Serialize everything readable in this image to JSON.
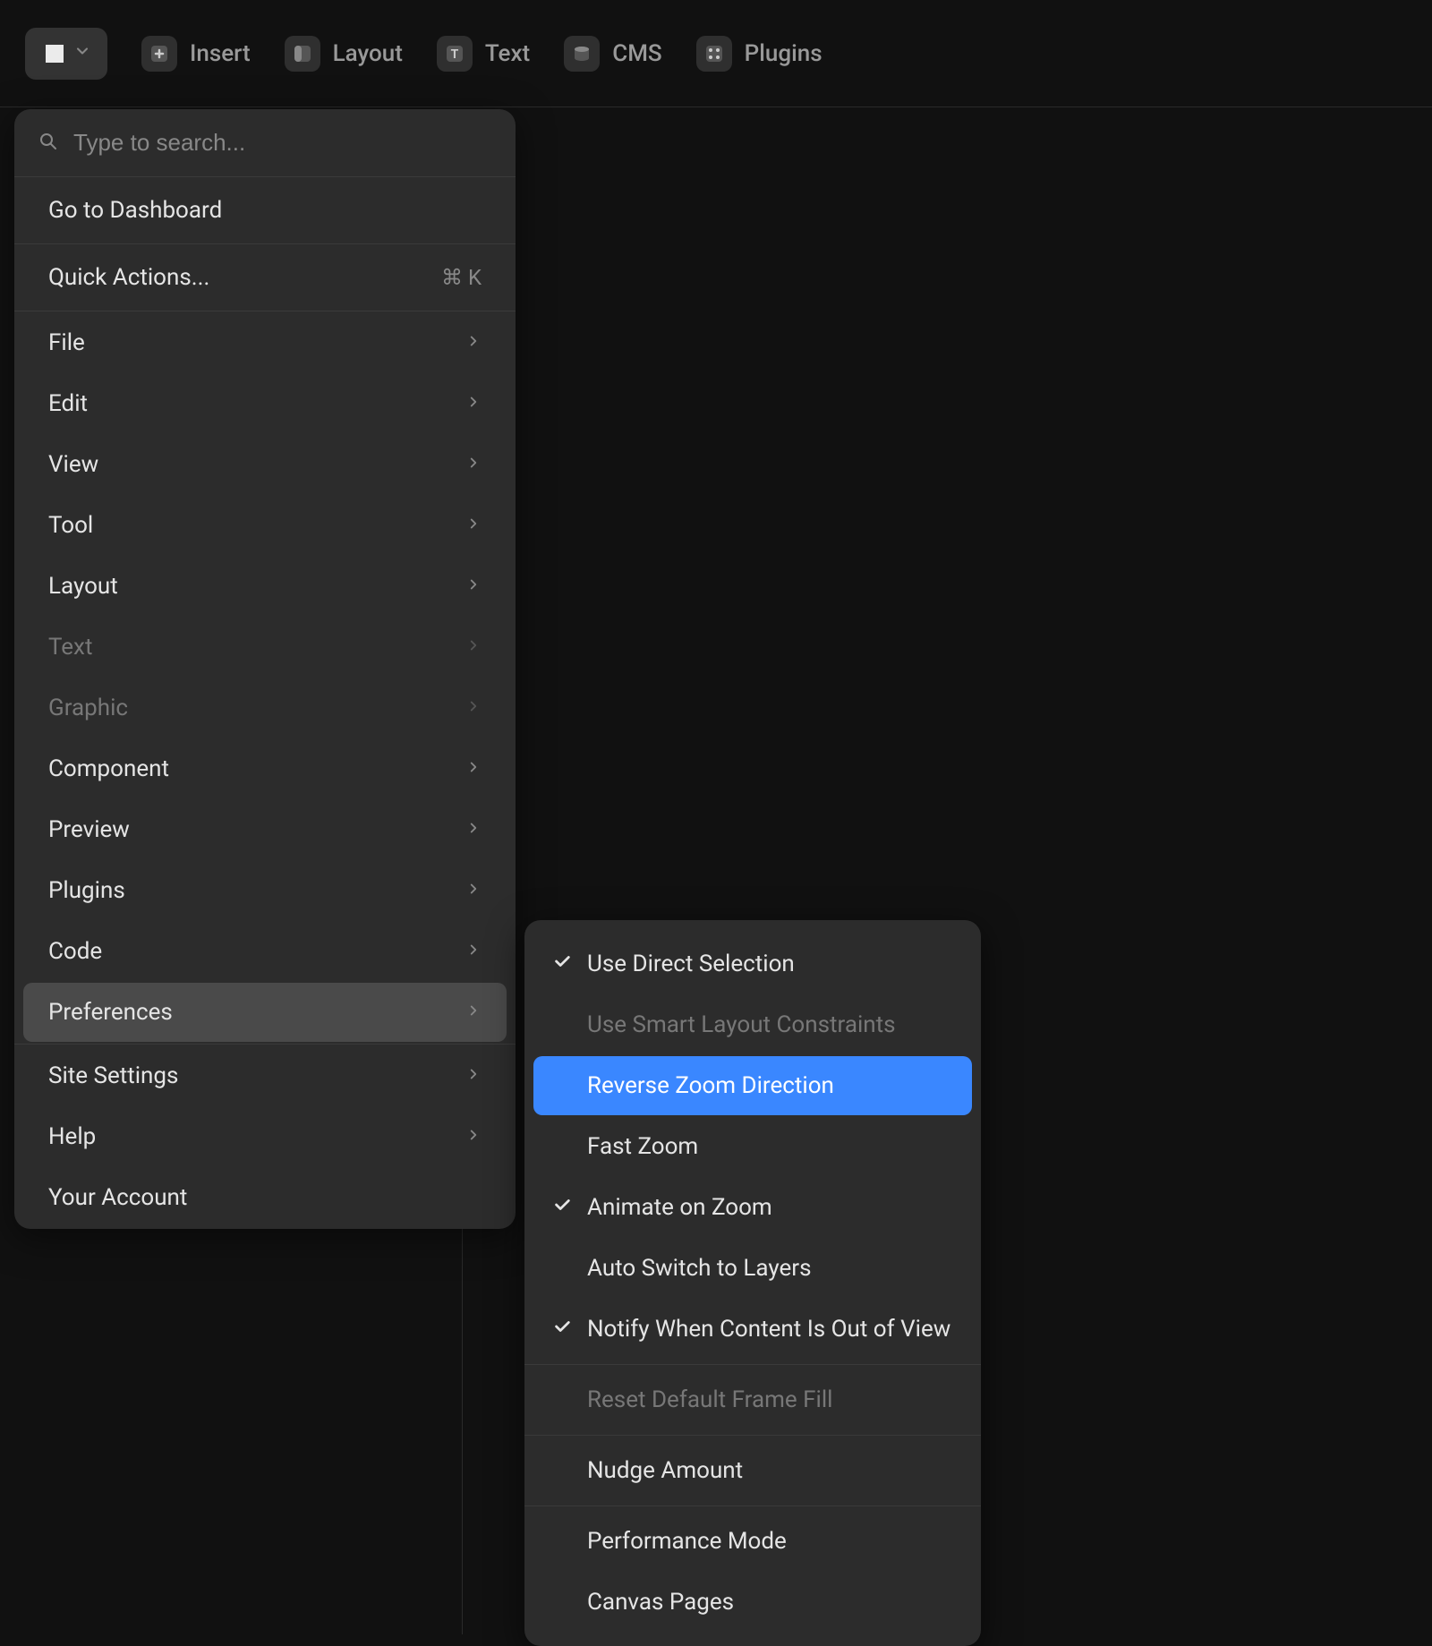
{
  "toolbar": {
    "items": [
      {
        "name": "insert-button",
        "label": "Insert",
        "icon": "plus-icon"
      },
      {
        "name": "layout-button",
        "label": "Layout",
        "icon": "layout-icon"
      },
      {
        "name": "text-button",
        "label": "Text",
        "icon": "text-icon"
      },
      {
        "name": "cms-button",
        "label": "CMS",
        "icon": "cms-icon"
      },
      {
        "name": "plugins-button",
        "label": "Plugins",
        "icon": "plugins-icon"
      }
    ]
  },
  "search": {
    "placeholder": "Type to search..."
  },
  "menu": {
    "sections": [
      {
        "items": [
          {
            "name": "menu-dashboard",
            "label": "Go to Dashboard",
            "submenu": false
          }
        ]
      },
      {
        "items": [
          {
            "name": "menu-quick-actions",
            "label": "Quick Actions...",
            "submenu": false,
            "shortcut": "⌘ K"
          }
        ]
      },
      {
        "tight": true,
        "items": [
          {
            "name": "menu-file",
            "label": "File",
            "submenu": true
          },
          {
            "name": "menu-edit",
            "label": "Edit",
            "submenu": true
          },
          {
            "name": "menu-view",
            "label": "View",
            "submenu": true
          },
          {
            "name": "menu-tool",
            "label": "Tool",
            "submenu": true
          },
          {
            "name": "menu-layout",
            "label": "Layout",
            "submenu": true
          },
          {
            "name": "menu-text",
            "label": "Text",
            "submenu": true,
            "disabled": true
          },
          {
            "name": "menu-graphic",
            "label": "Graphic",
            "submenu": true,
            "disabled": true
          },
          {
            "name": "menu-component",
            "label": "Component",
            "submenu": true
          },
          {
            "name": "menu-preview",
            "label": "Preview",
            "submenu": true
          },
          {
            "name": "menu-plugins",
            "label": "Plugins",
            "submenu": true
          },
          {
            "name": "menu-code",
            "label": "Code",
            "submenu": true
          },
          {
            "name": "menu-preferences",
            "label": "Preferences",
            "submenu": true,
            "selected": true
          }
        ]
      },
      {
        "tight": true,
        "items": [
          {
            "name": "menu-site-settings",
            "label": "Site Settings",
            "submenu": true
          },
          {
            "name": "menu-help",
            "label": "Help",
            "submenu": true
          },
          {
            "name": "menu-your-account",
            "label": "Your Account",
            "submenu": false
          }
        ]
      }
    ]
  },
  "submenu": {
    "sections": [
      {
        "items": [
          {
            "name": "pref-direct-selection",
            "label": "Use Direct Selection",
            "checked": true
          },
          {
            "name": "pref-smart-layout",
            "label": "Use Smart Layout Constraints",
            "disabled": true
          },
          {
            "name": "pref-reverse-zoom",
            "label": "Reverse Zoom Direction",
            "highlight": true
          },
          {
            "name": "pref-fast-zoom",
            "label": "Fast Zoom"
          },
          {
            "name": "pref-animate-zoom",
            "label": "Animate on Zoom",
            "checked": true
          },
          {
            "name": "pref-auto-switch-layers",
            "label": "Auto Switch to Layers"
          },
          {
            "name": "pref-notify-out-of-view",
            "label": "Notify When Content Is Out of View",
            "checked": true
          }
        ]
      },
      {
        "items": [
          {
            "name": "pref-reset-frame-fill",
            "label": "Reset Default Frame Fill",
            "disabled": true
          }
        ]
      },
      {
        "items": [
          {
            "name": "pref-nudge-amount",
            "label": "Nudge Amount"
          }
        ]
      },
      {
        "items": [
          {
            "name": "pref-performance-mode",
            "label": "Performance Mode"
          },
          {
            "name": "pref-canvas-pages",
            "label": "Canvas Pages"
          }
        ]
      }
    ]
  }
}
